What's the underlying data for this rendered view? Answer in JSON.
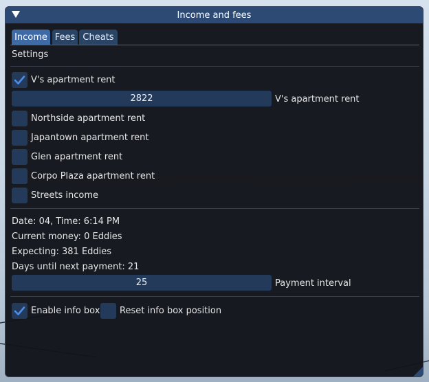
{
  "window": {
    "title": "Income and fees"
  },
  "tabs": [
    {
      "label": "Income",
      "active": true
    },
    {
      "label": "Fees",
      "active": false
    },
    {
      "label": "Cheats",
      "active": false
    }
  ],
  "settings_header": "Settings",
  "income_options": [
    {
      "label": "V's apartment rent",
      "checked": true
    },
    {
      "label": "Northside apartment rent",
      "checked": false
    },
    {
      "label": "Japantown apartment rent",
      "checked": false
    },
    {
      "label": "Glen apartment rent",
      "checked": false
    },
    {
      "label": "Corpo Plaza apartment rent",
      "checked": false
    },
    {
      "label": "Streets income",
      "checked": false
    }
  ],
  "rent_slider": {
    "value": "2822",
    "label": "V's apartment rent"
  },
  "status": {
    "date_time": "Date: 04, Time: 6:14 PM",
    "current_money": "Current money: 0 Eddies",
    "expecting": "Expecting: 381 Eddies",
    "days_until_payment": "Days until next payment: 21"
  },
  "interval_slider": {
    "value": "25",
    "label": "Payment interval"
  },
  "info_box": {
    "enable_label": "Enable info box",
    "enable_checked": true,
    "reset_label": "Reset info box position",
    "reset_checked": false
  },
  "colors": {
    "titlebar": "#2c4a74",
    "active_tab": "#3e6aa6",
    "frame": "#243a5a",
    "checkmark": "#4d8ee8",
    "window_bg": "#12141a"
  }
}
